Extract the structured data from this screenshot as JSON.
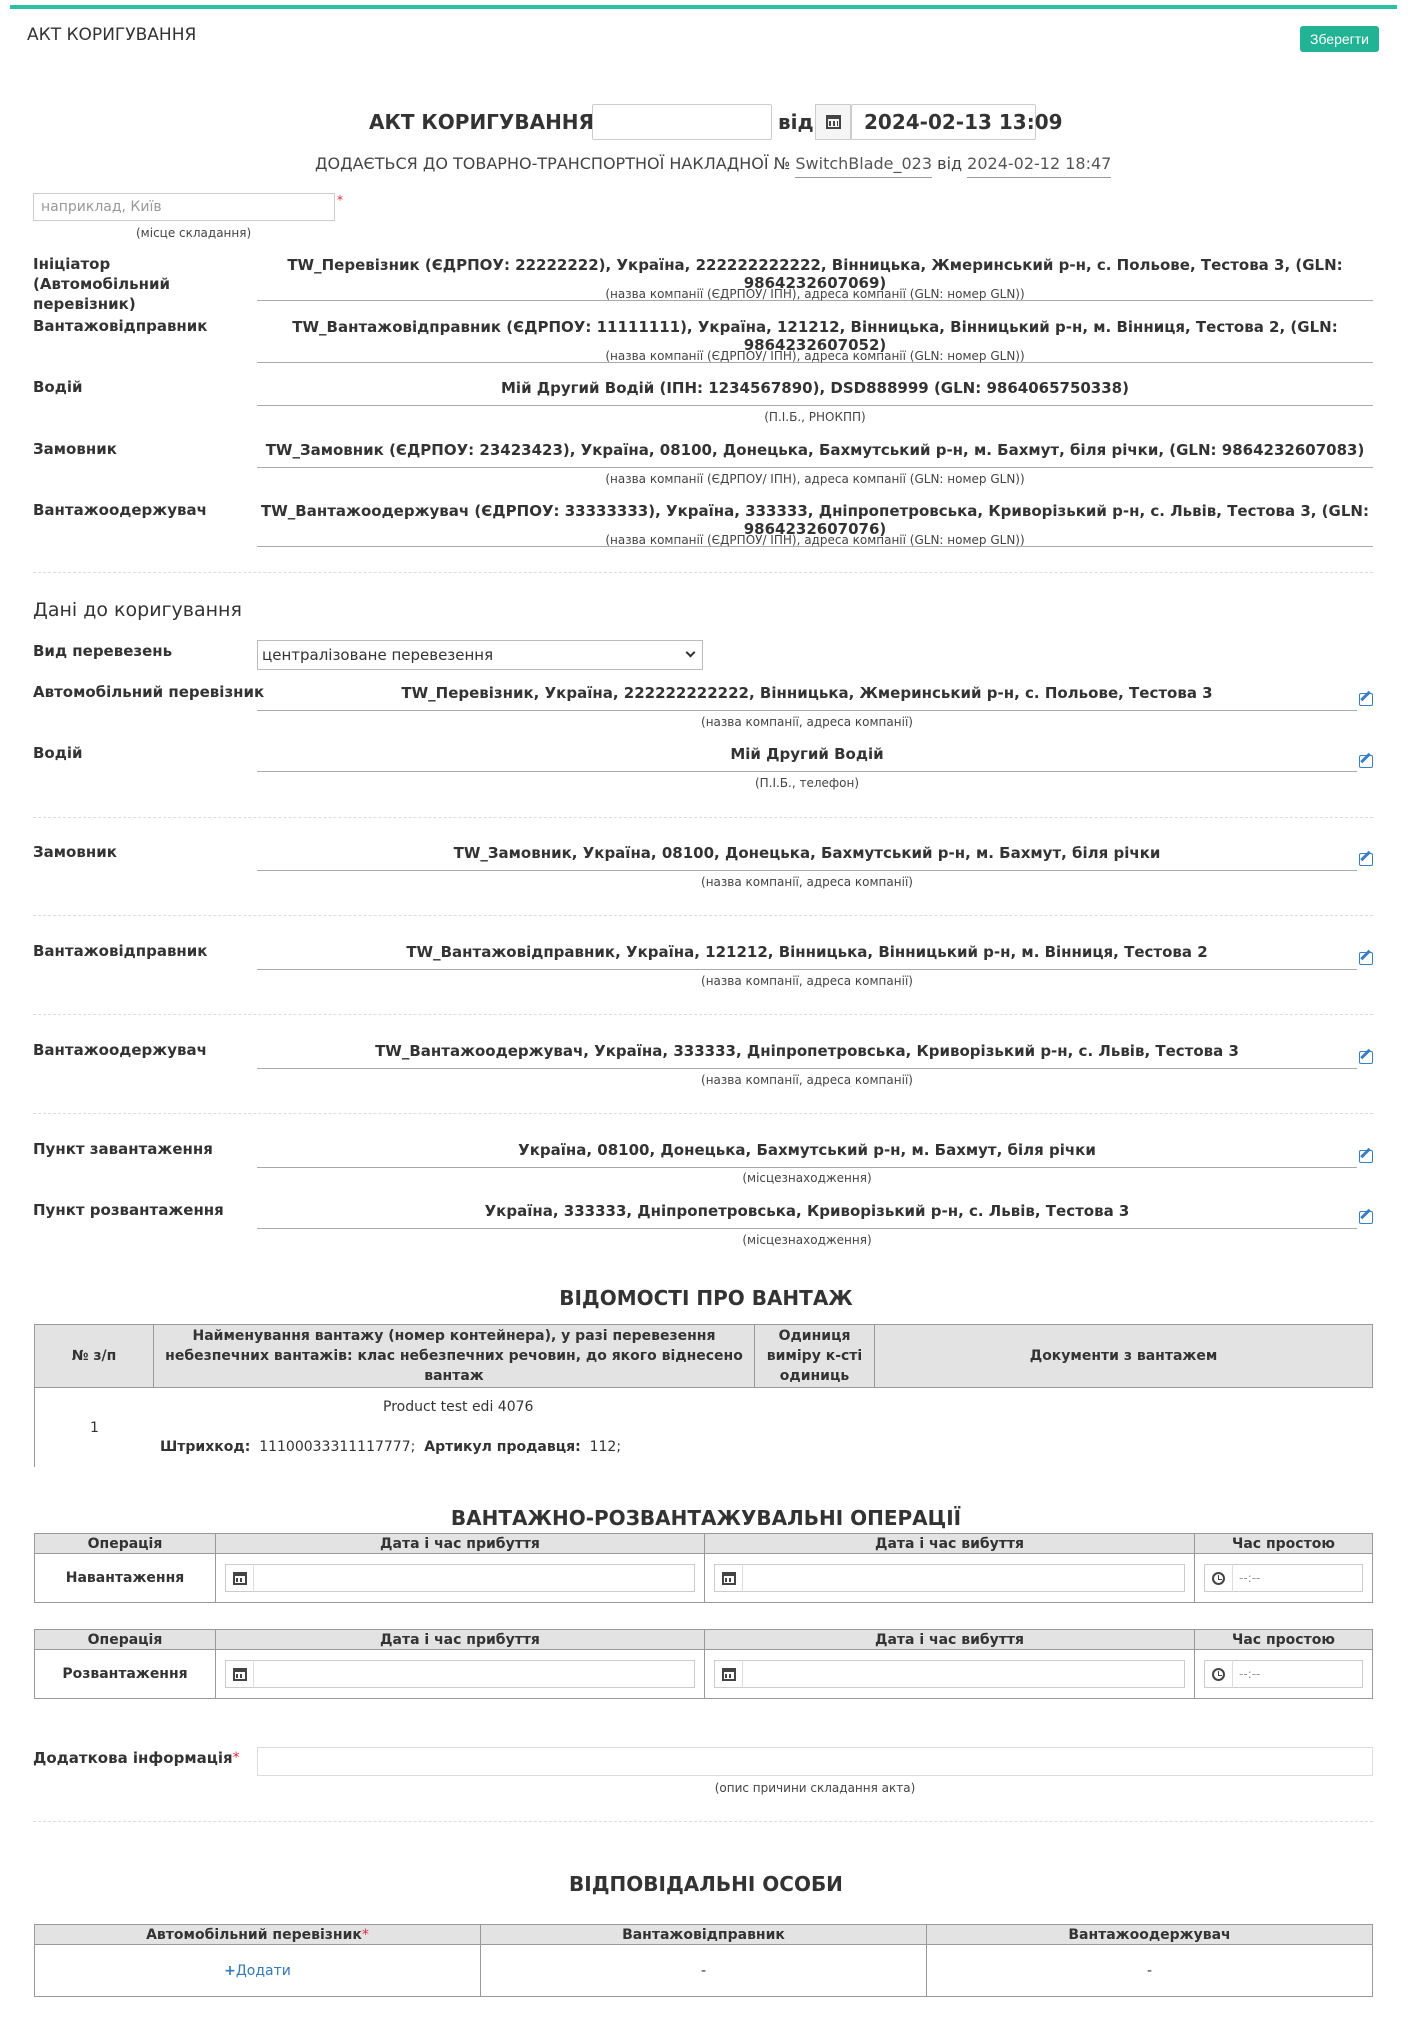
{
  "header": {
    "title": "АКТ КОРИГУВАННЯ",
    "save_label": "Зберегти"
  },
  "act": {
    "label": "АКТ КОРИГУВАННЯ №",
    "number_value": "",
    "from_label": "від",
    "date_value": "2024-02-13 13:09"
  },
  "attach": {
    "label": "ДОДАЄТЬСЯ ДО ТОВАРНО-ТРАНСПОРТНОЇ НАКЛАДНОЇ №",
    "waybill_no": "SwitchBlade_023",
    "from_label": "від",
    "waybill_date": "2024-02-12 18:47"
  },
  "place": {
    "placeholder": "наприклад, Київ",
    "hint": "(місце складання)"
  },
  "parties": [
    {
      "label": "Ініціатор (Автомобільний перевізник)",
      "value": "TW_Перевізник (ЄДРПОУ: 22222222), Україна, 222222222222, Вінницька, Жмеринський р-н, с. Польове, Тестова 3, (GLN: 9864232607069)",
      "hint": "(назва компанії (ЄДРПОУ/ ІПН), адреса компанії (GLN: номер GLN))"
    },
    {
      "label": "Вантажовідправник",
      "value": "TW_Вантажовідправник (ЄДРПОУ: 11111111), Україна, 121212, Вінницька, Вінницький р-н, м. Вінниця, Тестова 2, (GLN: 9864232607052)",
      "hint": "(назва компанії (ЄДРПОУ/ ІПН), адреса компанії (GLN: номер GLN))"
    },
    {
      "label": "Водій",
      "value": "Мій Другий Водій (ІПН: 1234567890), DSD888999 (GLN: 9864065750338)",
      "hint": "(П.І.Б., РНОКПП)"
    },
    {
      "label": "Замовник",
      "value": "TW_Замовник (ЄДРПОУ: 23423423), Україна, 08100, Донецька, Бахмутський р-н, м. Бахмут, біля річки, (GLN: 9864232607083)",
      "hint": "(назва компанії (ЄДРПОУ/ ІПН), адреса компанії (GLN: номер GLN))"
    },
    {
      "label": "Вантажоодержувач",
      "value": "TW_Вантажоодержувач (ЄДРПОУ: 33333333), Україна, 333333, Дніпропетровська, Криворізький р-н, с. Львів, Тестова 3, (GLN: 9864232607076)",
      "hint": "(назва компанії (ЄДРПОУ/ ІПН), адреса компанії (GLN: номер GLN))"
    }
  ],
  "correction": {
    "title": "Дані до коригування",
    "transport_type_label": "Вид перевезень",
    "transport_type_value": "централізоване перевезення",
    "rows": [
      {
        "label": "Автомобільний перевізник",
        "value": "TW_Перевізник, Україна, 222222222222, Вінницька, Жмеринський р-н, с. Польове, Тестова 3",
        "hint": "(назва компанії, адреса компанії)"
      },
      {
        "label": "Водій",
        "value": "Мій Другий Водій",
        "hint": "(П.І.Б., телефон)"
      },
      {
        "label": "Замовник",
        "value": "TW_Замовник, Україна, 08100, Донецька, Бахмутський р-н, м. Бахмут, біля річки",
        "hint": "(назва компанії, адреса компанії)"
      },
      {
        "label": "Вантажовідправник",
        "value": "TW_Вантажовідправник, Україна, 121212, Вінницька, Вінницький р-н, м. Вінниця, Тестова 2",
        "hint": "(назва компанії, адреса компанії)"
      },
      {
        "label": "Вантажоодержувач",
        "value": "TW_Вантажоодержувач, Україна, 333333, Дніпропетровська, Криворізький р-н, с. Львів, Тестова 3",
        "hint": "(назва компанії, адреса компанії)"
      },
      {
        "label": "Пункт завантаження",
        "value": "Україна, 08100, Донецька, Бахмутський р-н, м. Бахмут, біля річки",
        "hint": "(місцезнаходження)"
      },
      {
        "label": "Пункт розвантаження",
        "value": "Україна, 333333, Дніпропетровська, Криворізький р-н, с. Львів, Тестова 3",
        "hint": "(місцезнаходження)"
      }
    ]
  },
  "cargo": {
    "title": "ВІДОМОСТІ ПРО ВАНТАЖ",
    "headers": [
      "№ з/п",
      "Найменування вантажу (номер контейнера), у разі перевезення небезпечних вантажів: клас небезпечних речовин, до якого віднесено вантаж",
      "Одиниця виміру к-сті одиниць",
      "Документи з вантажем"
    ],
    "row": {
      "no": "1",
      "name": "Product test edi 4076",
      "barcode_label": "Штрихкод:",
      "barcode": "11100033311117777;",
      "article_label": "Артикул продавця:",
      "article": "112;"
    }
  },
  "operations": {
    "title": "ВАНТАЖНО-РОЗВАНТАЖУВАЛЬНІ ОПЕРАЦІЇ",
    "headers": [
      "Операція",
      "Дата і час прибуття",
      "Дата і час вибуття",
      "Час простою"
    ],
    "loading": "Навантаження",
    "unloading": "Розвантаження",
    "time_placeholder": "--:--"
  },
  "additional": {
    "label": "Додаткова інформація",
    "hint": "(опис причини складання акта)"
  },
  "responsible": {
    "title": "ВІДПОВІДАЛЬНІ ОСОБИ",
    "headers": [
      "Автомобільний перевізник",
      "Вантажовідправник",
      "Вантажоодержувач"
    ],
    "add_label": "Додати",
    "shipper_value": "-",
    "consignee_value": "-"
  },
  "colors": {
    "accent": "#2bbfa3",
    "save": "#22b394",
    "link": "#337ab7",
    "required": "#e2263b"
  }
}
